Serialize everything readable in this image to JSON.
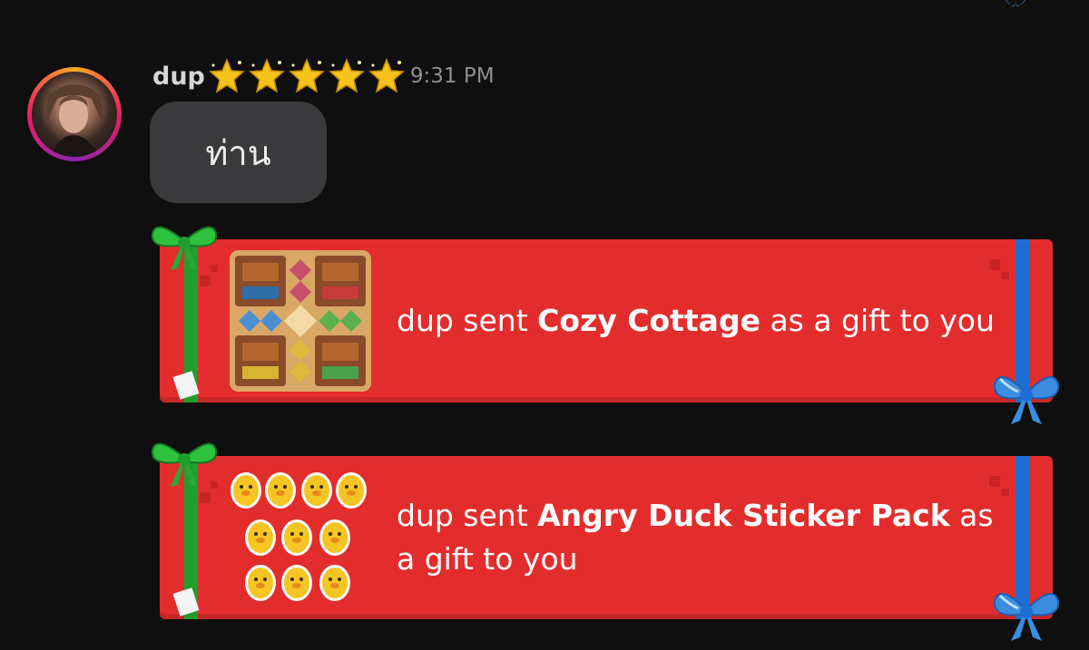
{
  "message": {
    "username": "dup",
    "rating_stars": 5,
    "timestamp": "9:31 PM",
    "bubble_text": "ท่าน"
  },
  "gifts": [
    {
      "prefix": "dup sent ",
      "item_name": "Cozy Cottage",
      "suffix": " as a gift to you",
      "thumbnail_icon": "ludo-board-icon"
    },
    {
      "prefix": "dup sent ",
      "item_name": "Angry Duck Sticker Pack",
      "suffix": " as a gift to you",
      "thumbnail_icon": "duck-stickers-icon"
    }
  ],
  "colors": {
    "background": "#0f0f10",
    "card_red": "#e32d2d",
    "ribbon_green": "#1f9e2e",
    "ribbon_blue": "#1d6fd6",
    "bubble_gray": "#3a3a3c",
    "star_gold": "#f5c21b"
  }
}
